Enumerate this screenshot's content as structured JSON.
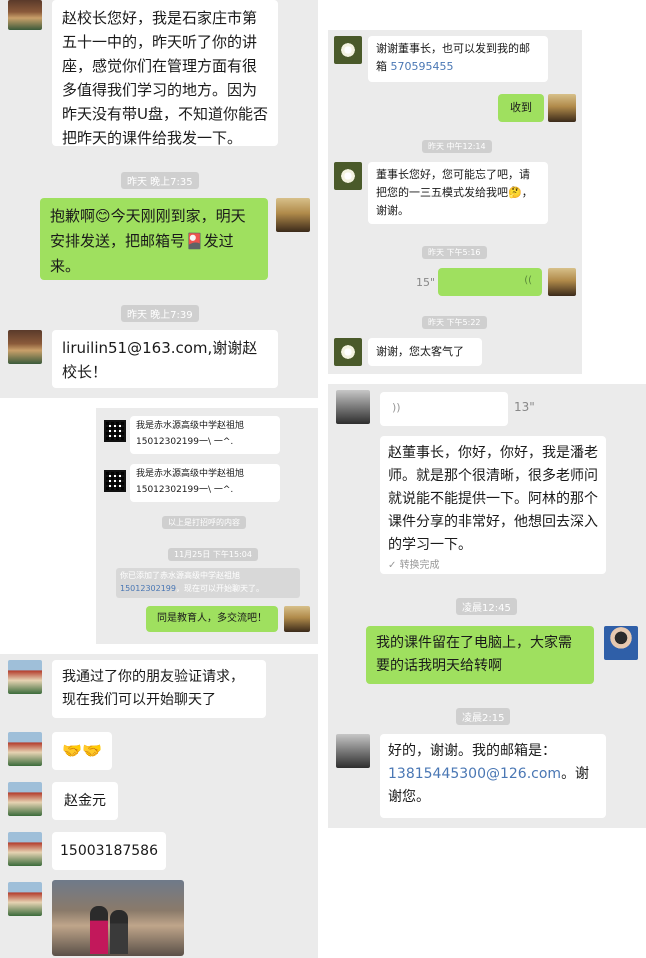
{
  "panel_a": {
    "msg1": "赵校长您好，我是石家庄市第五十一中的，昨天听了你的讲座，感觉你们在管理方面有很多值得我们学习的地方。因为昨天没有带U盘，不知道你能否把昨天的课件给我发一下。",
    "time1": "昨天 晚上7:35",
    "msg2": "抱歉啊😊今天刚刚到家，明天安排发送，把邮箱号🎴发过来。",
    "time2": "昨天 晚上7:39",
    "msg3": "liruilin51@163.com,谢谢赵校长！"
  },
  "panel_b": {
    "msg1_a": "谢谢董事长，也可以发到我的邮箱",
    "msg1_email": "570595455",
    "msg2": "收到",
    "time1": "昨天 中午12:14",
    "msg3": "董事长您好，您可能忘了吧，请把您的一三五模式发给我吧🤔，谢谢。",
    "time2": "昨天 下午5:16",
    "voice_len": "15\"",
    "voice_icon": "((",
    "time3": "昨天 下午5:22",
    "msg4": "谢谢，您太客气了"
  },
  "panel_c": {
    "line1_a": "我是赤水源高级中学赵祖旭",
    "line1_b": "15012302199一\\ 一^.",
    "line2_a": "我是赤水源高级中学赵祖旭",
    "line2_b": "15012302199一\\ 一^.",
    "sys1": "以上是打招呼的内容",
    "time1": "11月25日 下午15:04",
    "sys2_a": "你已添加了赤水源高级中学赵祖旭",
    "sys2_b": "15012302199",
    "sys2_c": "，现在可以开始聊天了。",
    "msg": "同是教育人，多交流吧！"
  },
  "panel_d": {
    "voice_icon": "))",
    "voice_len": "13\"",
    "msg1": "赵董事长，你好，你好，我是潘老师。就是那个很清晰，很多老师问就说能不能提供一下。阿林的那个课件分享的非常好，他想回去深入的学习一下。",
    "convert_done": "转换完成",
    "time1": "凌晨12:45",
    "msg2": "我的课件留在了电脑上，大家需要的话我明天给转啊",
    "time2": "凌晨2:15",
    "msg3_a": "好的，谢谢。我的邮箱是：",
    "msg3_email": "13815445300@126.com",
    "msg3_b": "。谢谢您。"
  },
  "panel_e": {
    "msg1": "我通过了你的朋友验证请求，现在我们可以开始聊天了",
    "msg2": "🤝🤝",
    "msg3": "赵金元",
    "msg4": "15003187586"
  },
  "colors": {
    "chat_bg": "#ebebeb",
    "green_bubble": "#9fe05f",
    "white_bubble": "#ffffff",
    "link": "#4a77b4"
  }
}
